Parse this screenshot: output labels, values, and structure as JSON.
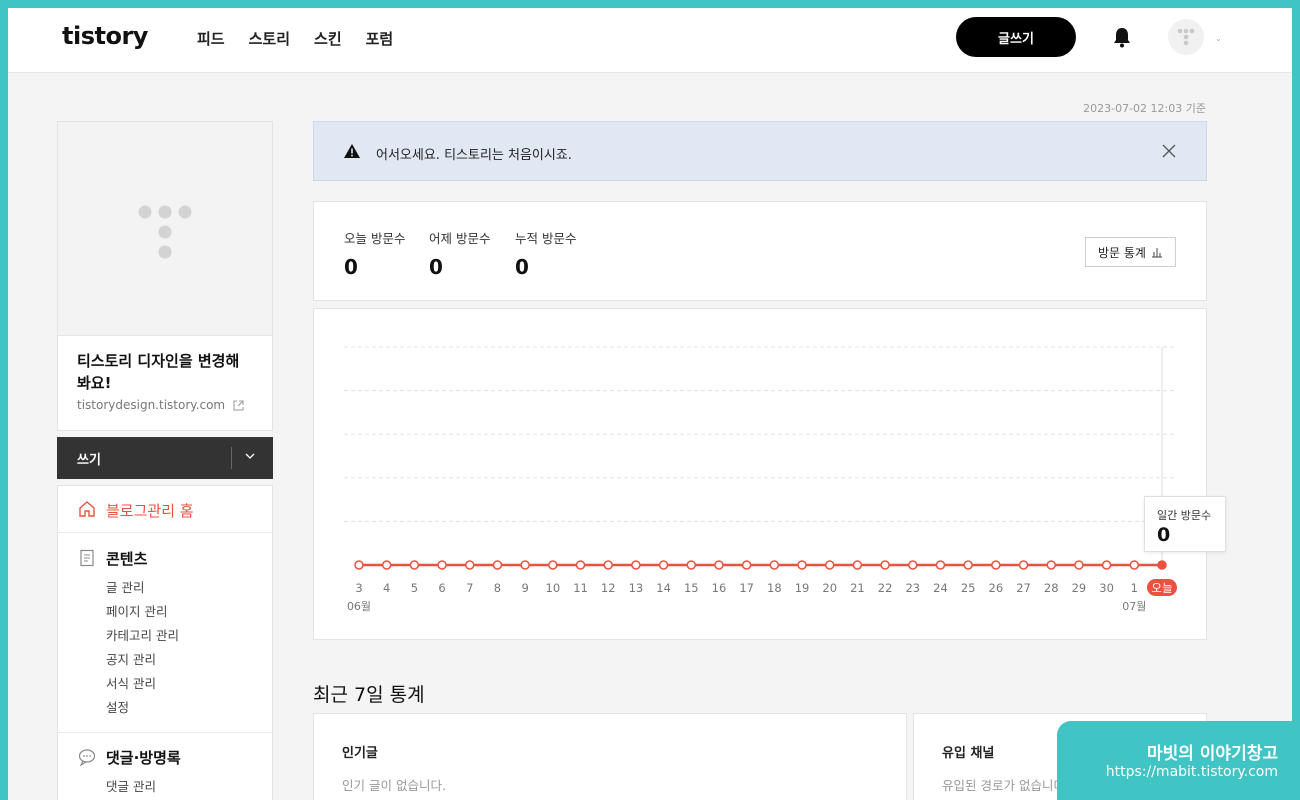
{
  "header": {
    "logo": "tistory",
    "nav": [
      "피드",
      "스토리",
      "스킨",
      "포럼"
    ],
    "write_button": "글쓰기"
  },
  "basis_time": "2023-07-02 12:03 기준",
  "blog": {
    "title": "티스토리 디자인을 변경해 봐요!",
    "url": "tistorydesign.tistory.com"
  },
  "write_bar": {
    "label": "쓰기"
  },
  "menu": {
    "home": "블로그관리 홈",
    "content": {
      "title": "콘텐츠",
      "items": [
        "글 관리",
        "페이지 관리",
        "카테고리 관리",
        "공지 관리",
        "서식 관리",
        "설정"
      ]
    },
    "comments": {
      "title": "댓글·방명록",
      "items": [
        "댓글 관리"
      ]
    }
  },
  "notice": {
    "text": "어서오세요. 티스토리는 처음이시죠."
  },
  "visits": {
    "stats": [
      {
        "label": "오늘 방문수",
        "value": "0"
      },
      {
        "label": "어제 방문수",
        "value": "0"
      },
      {
        "label": "누적 방문수",
        "value": "0"
      }
    ],
    "stats_button": "방문 통계"
  },
  "tooltip": {
    "label": "일간 방문수",
    "value": "0"
  },
  "chart_data": {
    "type": "line",
    "title": "",
    "xlabel": "",
    "ylabel": "",
    "categories": [
      "3",
      "4",
      "5",
      "6",
      "7",
      "8",
      "9",
      "10",
      "11",
      "12",
      "13",
      "14",
      "15",
      "16",
      "17",
      "18",
      "19",
      "20",
      "21",
      "22",
      "23",
      "24",
      "25",
      "26",
      "27",
      "28",
      "29",
      "30",
      "1",
      "오늘"
    ],
    "month_labels": [
      {
        "at": "3",
        "label": "06월"
      },
      {
        "at": "1",
        "label": "07월"
      }
    ],
    "series": [
      {
        "values": [
          0,
          0,
          0,
          0,
          0,
          0,
          0,
          0,
          0,
          0,
          0,
          0,
          0,
          0,
          0,
          0,
          0,
          0,
          0,
          0,
          0,
          0,
          0,
          0,
          0,
          0,
          0,
          0,
          0,
          0
        ]
      }
    ],
    "grid": true,
    "line_color": "#e8523f",
    "today_color": "#e8523f"
  },
  "recent": {
    "title": "최근 7일 통계",
    "popular": {
      "title": "인기글",
      "empty": "인기 글이 없습니다."
    },
    "channel": {
      "title": "유입 채널",
      "empty": "유입된 경로가 없습니다"
    }
  },
  "watermark": {
    "title": "마빗의 이야기창고",
    "url": "https://mabit.tistory.com"
  }
}
